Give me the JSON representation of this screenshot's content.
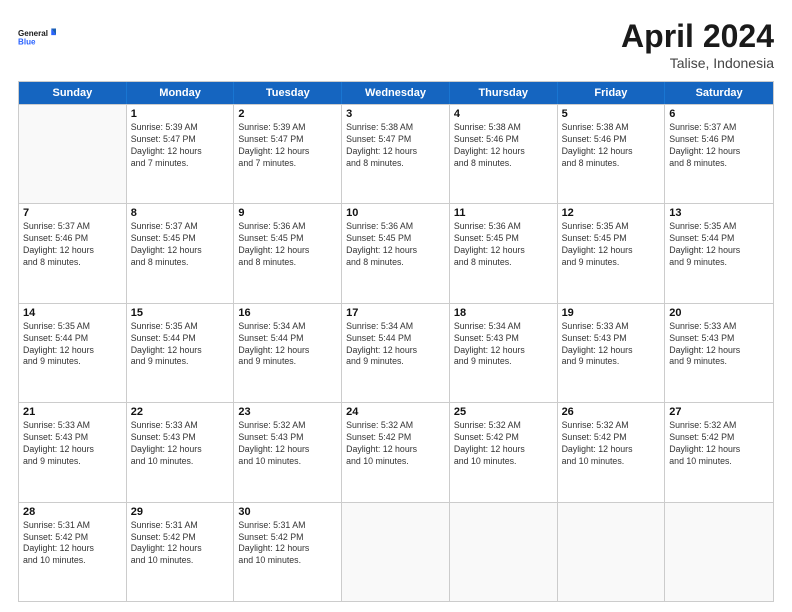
{
  "logo": {
    "line1": "General",
    "line2": "Blue"
  },
  "title": "April 2024",
  "location": "Talise, Indonesia",
  "days_of_week": [
    "Sunday",
    "Monday",
    "Tuesday",
    "Wednesday",
    "Thursday",
    "Friday",
    "Saturday"
  ],
  "weeks": [
    [
      {
        "day": "",
        "info": ""
      },
      {
        "day": "1",
        "info": "Sunrise: 5:39 AM\nSunset: 5:47 PM\nDaylight: 12 hours\nand 7 minutes."
      },
      {
        "day": "2",
        "info": "Sunrise: 5:39 AM\nSunset: 5:47 PM\nDaylight: 12 hours\nand 7 minutes."
      },
      {
        "day": "3",
        "info": "Sunrise: 5:38 AM\nSunset: 5:47 PM\nDaylight: 12 hours\nand 8 minutes."
      },
      {
        "day": "4",
        "info": "Sunrise: 5:38 AM\nSunset: 5:46 PM\nDaylight: 12 hours\nand 8 minutes."
      },
      {
        "day": "5",
        "info": "Sunrise: 5:38 AM\nSunset: 5:46 PM\nDaylight: 12 hours\nand 8 minutes."
      },
      {
        "day": "6",
        "info": "Sunrise: 5:37 AM\nSunset: 5:46 PM\nDaylight: 12 hours\nand 8 minutes."
      }
    ],
    [
      {
        "day": "7",
        "info": "Sunrise: 5:37 AM\nSunset: 5:46 PM\nDaylight: 12 hours\nand 8 minutes."
      },
      {
        "day": "8",
        "info": "Sunrise: 5:37 AM\nSunset: 5:45 PM\nDaylight: 12 hours\nand 8 minutes."
      },
      {
        "day": "9",
        "info": "Sunrise: 5:36 AM\nSunset: 5:45 PM\nDaylight: 12 hours\nand 8 minutes."
      },
      {
        "day": "10",
        "info": "Sunrise: 5:36 AM\nSunset: 5:45 PM\nDaylight: 12 hours\nand 8 minutes."
      },
      {
        "day": "11",
        "info": "Sunrise: 5:36 AM\nSunset: 5:45 PM\nDaylight: 12 hours\nand 8 minutes."
      },
      {
        "day": "12",
        "info": "Sunrise: 5:35 AM\nSunset: 5:45 PM\nDaylight: 12 hours\nand 9 minutes."
      },
      {
        "day": "13",
        "info": "Sunrise: 5:35 AM\nSunset: 5:44 PM\nDaylight: 12 hours\nand 9 minutes."
      }
    ],
    [
      {
        "day": "14",
        "info": "Sunrise: 5:35 AM\nSunset: 5:44 PM\nDaylight: 12 hours\nand 9 minutes."
      },
      {
        "day": "15",
        "info": "Sunrise: 5:35 AM\nSunset: 5:44 PM\nDaylight: 12 hours\nand 9 minutes."
      },
      {
        "day": "16",
        "info": "Sunrise: 5:34 AM\nSunset: 5:44 PM\nDaylight: 12 hours\nand 9 minutes."
      },
      {
        "day": "17",
        "info": "Sunrise: 5:34 AM\nSunset: 5:44 PM\nDaylight: 12 hours\nand 9 minutes."
      },
      {
        "day": "18",
        "info": "Sunrise: 5:34 AM\nSunset: 5:43 PM\nDaylight: 12 hours\nand 9 minutes."
      },
      {
        "day": "19",
        "info": "Sunrise: 5:33 AM\nSunset: 5:43 PM\nDaylight: 12 hours\nand 9 minutes."
      },
      {
        "day": "20",
        "info": "Sunrise: 5:33 AM\nSunset: 5:43 PM\nDaylight: 12 hours\nand 9 minutes."
      }
    ],
    [
      {
        "day": "21",
        "info": "Sunrise: 5:33 AM\nSunset: 5:43 PM\nDaylight: 12 hours\nand 9 minutes."
      },
      {
        "day": "22",
        "info": "Sunrise: 5:33 AM\nSunset: 5:43 PM\nDaylight: 12 hours\nand 10 minutes."
      },
      {
        "day": "23",
        "info": "Sunrise: 5:32 AM\nSunset: 5:43 PM\nDaylight: 12 hours\nand 10 minutes."
      },
      {
        "day": "24",
        "info": "Sunrise: 5:32 AM\nSunset: 5:42 PM\nDaylight: 12 hours\nand 10 minutes."
      },
      {
        "day": "25",
        "info": "Sunrise: 5:32 AM\nSunset: 5:42 PM\nDaylight: 12 hours\nand 10 minutes."
      },
      {
        "day": "26",
        "info": "Sunrise: 5:32 AM\nSunset: 5:42 PM\nDaylight: 12 hours\nand 10 minutes."
      },
      {
        "day": "27",
        "info": "Sunrise: 5:32 AM\nSunset: 5:42 PM\nDaylight: 12 hours\nand 10 minutes."
      }
    ],
    [
      {
        "day": "28",
        "info": "Sunrise: 5:31 AM\nSunset: 5:42 PM\nDaylight: 12 hours\nand 10 minutes."
      },
      {
        "day": "29",
        "info": "Sunrise: 5:31 AM\nSunset: 5:42 PM\nDaylight: 12 hours\nand 10 minutes."
      },
      {
        "day": "30",
        "info": "Sunrise: 5:31 AM\nSunset: 5:42 PM\nDaylight: 12 hours\nand 10 minutes."
      },
      {
        "day": "",
        "info": ""
      },
      {
        "day": "",
        "info": ""
      },
      {
        "day": "",
        "info": ""
      },
      {
        "day": "",
        "info": ""
      }
    ]
  ]
}
